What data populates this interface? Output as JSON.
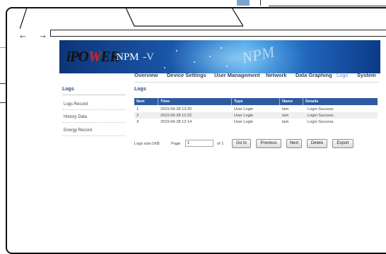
{
  "browser": {
    "back_glyph": "←",
    "forward_glyph": "→"
  },
  "banner": {
    "logo_part1": "iPO",
    "logo_part2": "W",
    "logo_part3": "ER",
    "product_name": "NPM",
    "product_tail": "-V",
    "watermark_text": "NPM"
  },
  "nav": {
    "items": [
      "Overview",
      "Device Settings",
      "User Management",
      "Network",
      "Data Graphing",
      "Logs",
      "System"
    ],
    "active": "Logs"
  },
  "sidebar": {
    "title": "Logs",
    "items": [
      "Logs Record",
      "History Data",
      "Energy Record"
    ]
  },
  "content": {
    "title": "Logs",
    "table": {
      "headers": [
        "Item",
        "Time",
        "Type",
        "Name",
        "Details"
      ],
      "rows": [
        [
          "1",
          "2015-06-28 13:20",
          "User Login",
          "tam",
          "Login Success."
        ],
        [
          "2",
          "2015-06-28 12:22",
          "User Login",
          "tam",
          "Login Success."
        ],
        [
          "3",
          "2015-06-28 12:14",
          "User Login",
          "tam",
          "Login Success."
        ]
      ]
    },
    "pager": {
      "log_size": "Logs size:1KB",
      "page_label": "Page",
      "page_value": "1",
      "of_label": "of 1",
      "goto": "Go to",
      "previous": "Previous",
      "next": "Next",
      "delete": "Delete",
      "export": "Export"
    }
  },
  "colors": {
    "banner_dark": "#0d3578",
    "banner_light": "#4aa6ea",
    "table_header": "#2e5aa0",
    "nav_active": "#6f84c6",
    "logo_accent": "#d62323"
  }
}
